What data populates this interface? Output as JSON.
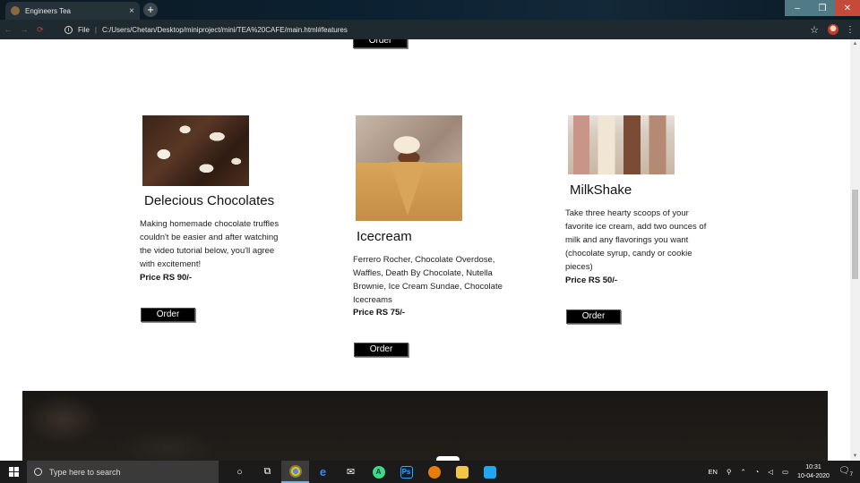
{
  "browser": {
    "tab_title": "Engineers Tea",
    "tab_close": "×",
    "new_tab": "+",
    "window_buttons": [
      "–",
      "❐",
      "✕"
    ],
    "nav_buttons": [
      "←",
      "→",
      "⟳"
    ],
    "file_label": "File",
    "url": "C:/Users/Chetan/Desktop/miniproject/mini/TEA%20CAFE/main.html#features"
  },
  "page": {
    "top_order_label": "Order",
    "cards": [
      {
        "title": "Delecious Chocolates",
        "description": "Making homemade chocolate truffles couldn't be easier and after watching the video tutorial below, you'll agree with excitement!",
        "price": "Price RS 90/-",
        "order_label": "Order",
        "image_icon": "chocolate-image"
      },
      {
        "title": "Icecream",
        "description": "Ferrero Rocher, Chocolate Overdose, Waffles, Death By Chocolate, Nutella Brownie, Ice Cream Sundae, Chocolate Icecreams",
        "price": "Price RS 75/-",
        "order_label": "Order",
        "image_icon": "icecream-image"
      },
      {
        "title": "MilkShake",
        "description": "Take three hearty scoops of your favorite ice cream, add two ounces of milk and any flavorings you want (chocolate syrup, candy or cookie pieces)",
        "price": "Price RS 50/-",
        "order_label": "Order",
        "image_icon": "milkshake-image"
      }
    ]
  },
  "taskbar": {
    "search_placeholder": "Type here to search",
    "apps": [
      "cortana",
      "task-view",
      "chrome",
      "edge",
      "mail",
      "android-studio",
      "photoshop",
      "blender",
      "file-explorer",
      "vscode"
    ],
    "ps_label": "Ps",
    "language": "EN",
    "time": "10:31",
    "date": "10-04-2020",
    "notification_count": "7"
  }
}
